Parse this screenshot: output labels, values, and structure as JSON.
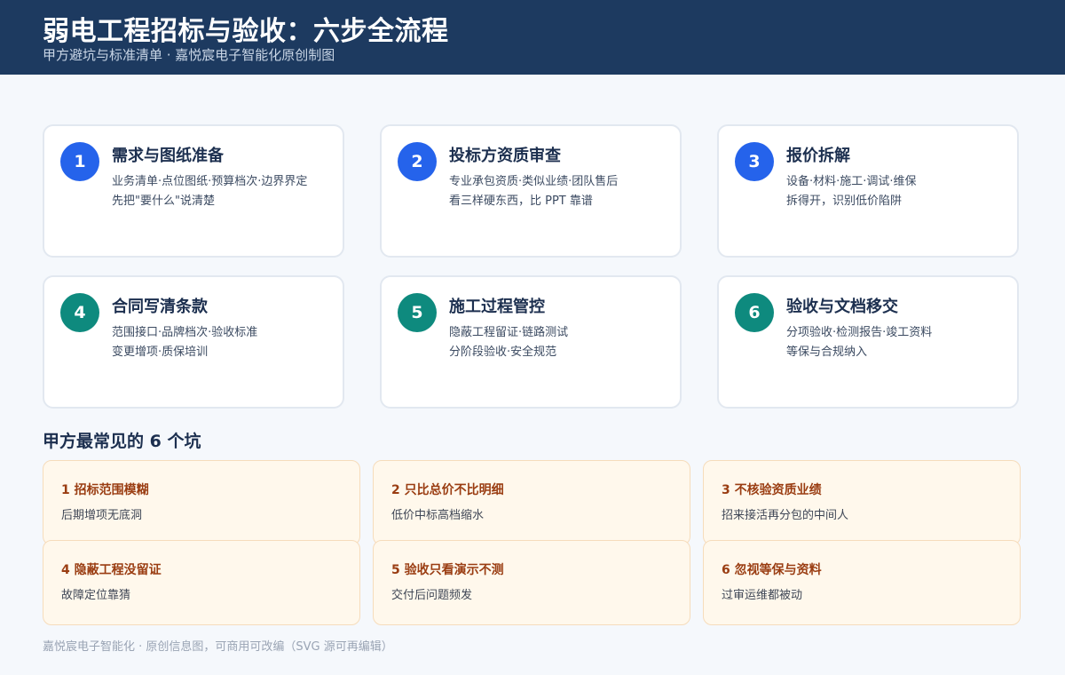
{
  "header": {
    "title": "弱电工程招标与验收：六步全流程",
    "subtitle": "甲方避坑与标准清单 · 嘉悦宸电子智能化原创制图"
  },
  "steps": [
    {
      "num": "1",
      "title": "需求与图纸准备",
      "line1": "业务清单·点位图纸·预算档次·边界界定",
      "line2": "先把\"要什么\"说清楚",
      "color": "#2563eb"
    },
    {
      "num": "2",
      "title": "投标方资质审查",
      "line1": "专业承包资质·类似业绩·团队售后",
      "line2": "看三样硬东西，比 PPT 靠谱",
      "color": "#2563eb"
    },
    {
      "num": "3",
      "title": "报价拆解",
      "line1": "设备·材料·施工·调试·维保",
      "line2": "拆得开，识别低价陷阱",
      "color": "#2563eb"
    },
    {
      "num": "4",
      "title": "合同写清条款",
      "line1": "范围接口·品牌档次·验收标准",
      "line2": "变更增项·质保培训",
      "color": "#0e8a7e"
    },
    {
      "num": "5",
      "title": "施工过程管控",
      "line1": "隐蔽工程留证·链路测试",
      "line2": "分阶段验收·安全规范",
      "color": "#0e8a7e"
    },
    {
      "num": "6",
      "title": "验收与文档移交",
      "line1": "分项验收·检测报告·竣工资料",
      "line2": "等保与合规纳入",
      "color": "#0e8a7e"
    }
  ],
  "pits": {
    "heading": "甲方最常见的 6 个坑",
    "items": [
      {
        "title": "1 招标范围模糊",
        "desc": "后期增项无底洞"
      },
      {
        "title": "2 只比总价不比明细",
        "desc": "低价中标高档缩水"
      },
      {
        "title": "3 不核验资质业绩",
        "desc": "招来接活再分包的中间人"
      },
      {
        "title": "4 隐蔽工程没留证",
        "desc": "故障定位靠猜"
      },
      {
        "title": "5 验收只看演示不测",
        "desc": "交付后问题频发"
      },
      {
        "title": "6 忽视等保与资料",
        "desc": "过审运维都被动"
      }
    ]
  },
  "footer": "嘉悦宸电子智能化 · 原创信息图，可商用可改编（SVG 源可再编辑）"
}
